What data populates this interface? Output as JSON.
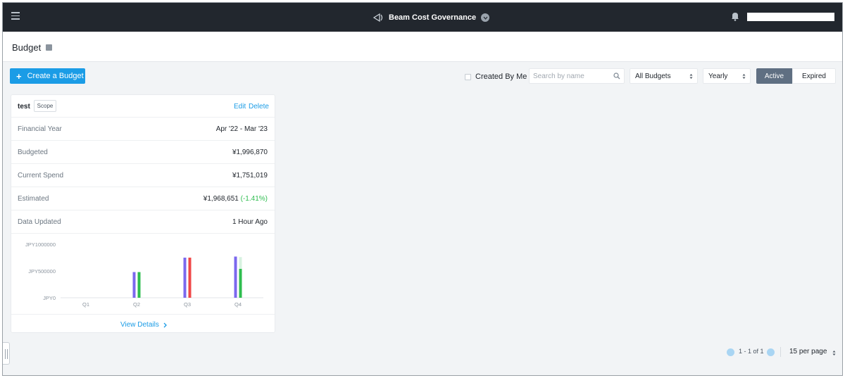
{
  "topbar": {
    "app_title": "Beam Cost Governance",
    "icons": [
      "hamburger-icon",
      "beam-logo-icon",
      "chevron-down-icon",
      "bell-icon"
    ]
  },
  "header": {
    "title": "Budget"
  },
  "toolbar": {
    "create_label": "Create a Budget",
    "created_by_me_label": "Created By Me",
    "search_placeholder": "Search by name",
    "budget_filter": "All Budgets",
    "period_filter": "Yearly",
    "tabs": [
      "Active",
      "Expired"
    ],
    "active_tab": "Active"
  },
  "card": {
    "name": "test",
    "scope_label": "Scope",
    "edit_label": "Edit",
    "delete_label": "Delete",
    "rows": [
      {
        "label": "Financial Year",
        "value": "Apr '22 - Mar '23"
      },
      {
        "label": "Budgeted",
        "value": "¥1,996,870"
      },
      {
        "label": "Current Spend",
        "value": "¥1,751,019"
      },
      {
        "label": "Estimated",
        "value": "¥1,968,651",
        "extra": "(-1.41%)"
      },
      {
        "label": "Data Updated",
        "value": "1 Hour Ago"
      }
    ],
    "view_details_label": "View Details",
    "colors": {
      "accent": "#1b9ce6",
      "positive": "#2ebd4f"
    }
  },
  "chart_data": {
    "type": "bar",
    "categories": [
      "Q1",
      "Q2",
      "Q3",
      "Q4"
    ],
    "y_ticks": [
      "JPY0",
      "JPY500000",
      "JPY1000000"
    ],
    "ylim": [
      0,
      1000000
    ],
    "series": [
      {
        "color": "#7b68ee",
        "values": [
          0,
          480000,
          750000,
          770000
        ]
      },
      {
        "color": "#2ebd4f",
        "values": [
          0,
          480000,
          0,
          540000
        ]
      },
      {
        "color": "#f04848",
        "values": [
          0,
          0,
          750000,
          0
        ]
      },
      {
        "color": "#d7f2e0",
        "values": [
          0,
          0,
          0,
          760000
        ]
      }
    ],
    "grid": false,
    "legend": "none"
  },
  "pagination": {
    "range": "1 - 1 of 1",
    "per_page": "15 per page"
  }
}
